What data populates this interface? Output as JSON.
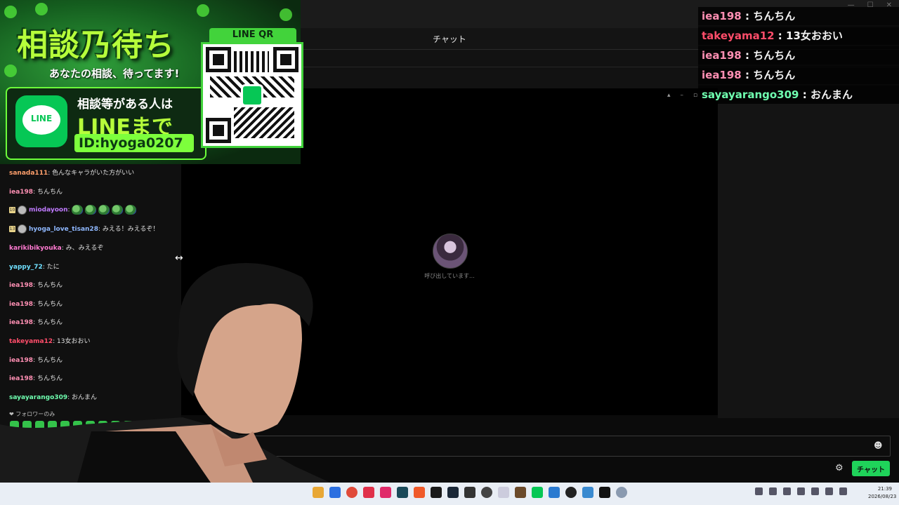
{
  "header": {
    "title": "チャット"
  },
  "call": {
    "status": "呼び出しています..."
  },
  "chat": {
    "messages": [
      {
        "user": "sanada111",
        "text": "色んなキャラがいた方がいい",
        "color": "#ff9f6b"
      },
      {
        "user": "iea198",
        "text": "ちんちん",
        "color": "#ff8fb3"
      },
      {
        "user": "miodayoon",
        "text": "",
        "color": "#c07bff",
        "badge": "10",
        "emotes": 5
      },
      {
        "user": "hyoga_love_tisan28",
        "text": "みえる！みえるぞ！",
        "color": "#8fb8ff",
        "badge": "13"
      },
      {
        "user": "karikibikyouka",
        "text": "み、みえるぞ",
        "color": "#ff7ad1"
      },
      {
        "user": "yappy_72",
        "text": "たに",
        "color": "#6fe0ff"
      },
      {
        "user": "iea198",
        "text": "ちんちん",
        "color": "#ff8fb3"
      },
      {
        "user": "iea198",
        "text": "ちんちん",
        "color": "#ff8fb3"
      },
      {
        "user": "iea198",
        "text": "ちんちん",
        "color": "#ff8fb3"
      },
      {
        "user": "takeyama12",
        "text": "13女おおい",
        "color": "#ff4d6a"
      },
      {
        "user": "iea198",
        "text": "ちんちん",
        "color": "#ff8fb3"
      },
      {
        "user": "iea198",
        "text": "ちんちん",
        "color": "#ff8fb3"
      },
      {
        "user": "sayayarango309",
        "text": "おんまん",
        "color": "#6fffb0"
      }
    ],
    "follower_only": "❤ フォロワーのみ",
    "send_label": "チャット"
  },
  "overlay": {
    "lines": [
      {
        "user": "iea198",
        "text": "ちんちん",
        "color": "#ff8fb3"
      },
      {
        "user": "takeyama12",
        "text": "13女おおい",
        "color": "#ff4d6a"
      },
      {
        "user": "iea198",
        "text": "ちんちん",
        "color": "#ff8fb3"
      },
      {
        "user": "iea198",
        "text": "ちんちん",
        "color": "#ff8fb3"
      },
      {
        "user": "sayayarango309",
        "text": "おんまん",
        "color": "#6fffb0"
      }
    ]
  },
  "banner": {
    "title": "相談乃待ち",
    "subtitle": "あなたの相談、待ってます!",
    "line1": "相談等がある人は",
    "line2": "LINEまで",
    "id": "ID:hyoga0207",
    "qr_label": "LINE QR",
    "logo_text": "LINE"
  },
  "taskbar": {
    "time": "21:39",
    "date": "2026/08/23"
  },
  "icons": {
    "emoji": "☻",
    "settings": "⚙",
    "pin": "📌"
  }
}
